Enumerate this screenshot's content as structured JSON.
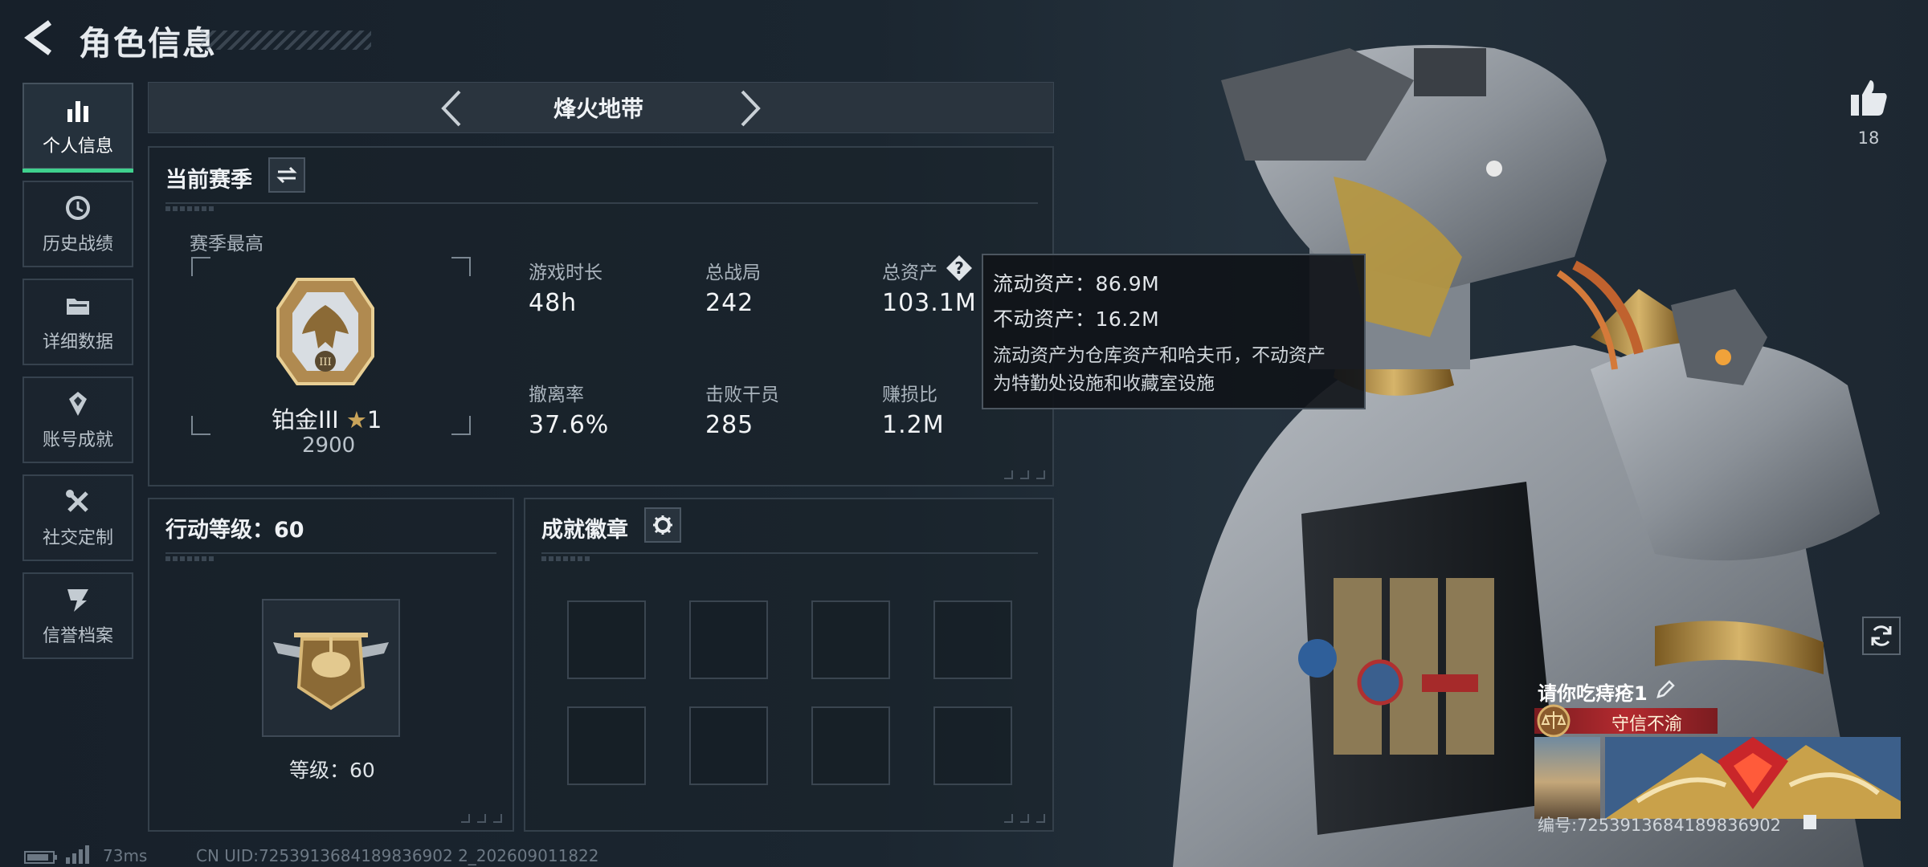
{
  "header": {
    "title": "角色信息"
  },
  "sidebar": {
    "items": [
      {
        "label": "个人信息",
        "icon": "bar-chart-icon",
        "active": true
      },
      {
        "label": "历史战绩",
        "icon": "clock-history-icon",
        "active": false
      },
      {
        "label": "详细数据",
        "icon": "folder-icon",
        "active": false
      },
      {
        "label": "账号成就",
        "icon": "achievement-icon",
        "active": false
      },
      {
        "label": "社交定制",
        "icon": "tools-icon",
        "active": false
      },
      {
        "label": "信誉档案",
        "icon": "reputation-icon",
        "active": false
      }
    ]
  },
  "mode": {
    "title": "烽火地带"
  },
  "season": {
    "title": "当前赛季",
    "best_label": "赛季最高",
    "rank_name": "铂金III",
    "rank_stars": "1",
    "rank_score": "2900",
    "stats": [
      {
        "label": "游戏时长",
        "value": "48h"
      },
      {
        "label": "总战局",
        "value": "242"
      },
      {
        "label": "总资产",
        "value": "103.1M"
      },
      {
        "label": "撤离率",
        "value": "37.6%"
      },
      {
        "label": "击败干员",
        "value": "285"
      },
      {
        "label": "赚损比",
        "value": "1.2M"
      }
    ]
  },
  "tooltip": {
    "line1": "流动资产：86.9M",
    "line2": "不动资产：16.2M",
    "desc1": "流动资产为仓库资产和哈夫币，不动资产",
    "desc2": "为特勤处设施和收藏室设施"
  },
  "action_level": {
    "title": "行动等级：60",
    "level_label": "等级：60"
  },
  "badges": {
    "title": "成就徽章",
    "slots": 8
  },
  "profile": {
    "likes": "18",
    "name": "请你吃痔疮1",
    "title_plate": "守信不渝",
    "id_text": "编号:7253913684189836902"
  },
  "footer": {
    "ping": "73ms",
    "uid": "CN UID:7253913684189836902 2_202609011822"
  },
  "colors": {
    "accent": "#3fd18e",
    "title_red": "#b42a2f",
    "gold": "#c9a45a"
  }
}
